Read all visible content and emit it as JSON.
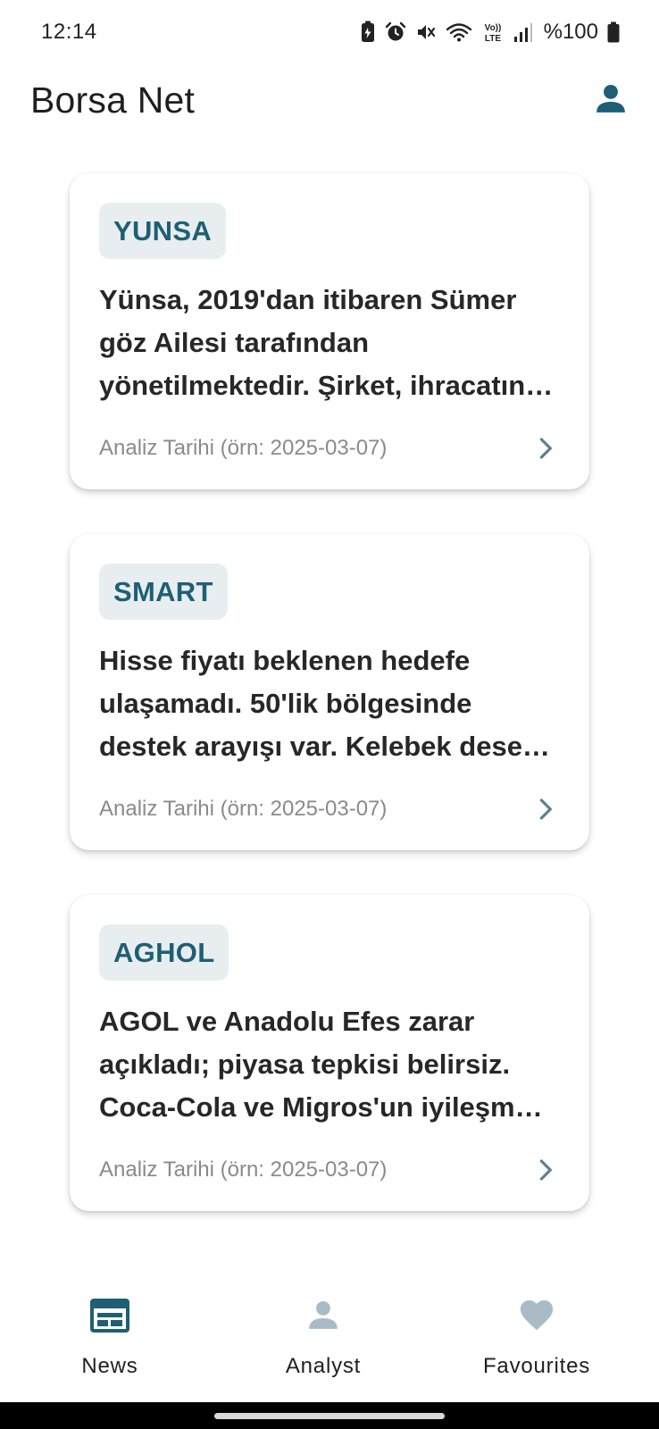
{
  "status_bar": {
    "time": "12:14",
    "battery": "%100",
    "icons": [
      "battery-saver-icon",
      "alarm-icon",
      "mute-icon",
      "wifi-icon",
      "volte-icon",
      "signal-icon",
      "battery-icon"
    ]
  },
  "app": {
    "title": "Borsa Net",
    "profile_icon": "person-icon"
  },
  "cards": [
    {
      "ticker": "YUNSA",
      "summary": "Yünsa, 2019'dan itibaren Sümer göz Ailesi tarafından yönetilmektedir. Şirket, ihracatın…",
      "date": "Analiz Tarihi (örn: 2025-03-07)"
    },
    {
      "ticker": "SMART",
      "summary": "Hisse fiyatı beklenen hedefe ulaşamadı. 50'lik bölgesinde destek arayışı var. Kelebek dese…",
      "date": "Analiz Tarihi (örn: 2025-03-07)"
    },
    {
      "ticker": "AGHOL",
      "summary": "AGOL ve Anadolu Efes zarar açıkladı; piyasa tepkisi belirsiz. Coca-Cola ve Migros'un iyileşm…",
      "date": "Analiz Tarihi (örn: 2025-03-07)"
    }
  ],
  "bottom_nav": {
    "items": [
      {
        "label": "News",
        "icon": "newspaper-icon",
        "active": true
      },
      {
        "label": "Analyst",
        "icon": "person-icon",
        "active": false
      },
      {
        "label": "Favourites",
        "icon": "heart-icon",
        "active": false
      }
    ]
  },
  "colors": {
    "accent": "#1f5f75",
    "chip_bg": "#e8eef0",
    "inactive_icon": "#a9bcc6",
    "chevron": "#5b8193"
  }
}
